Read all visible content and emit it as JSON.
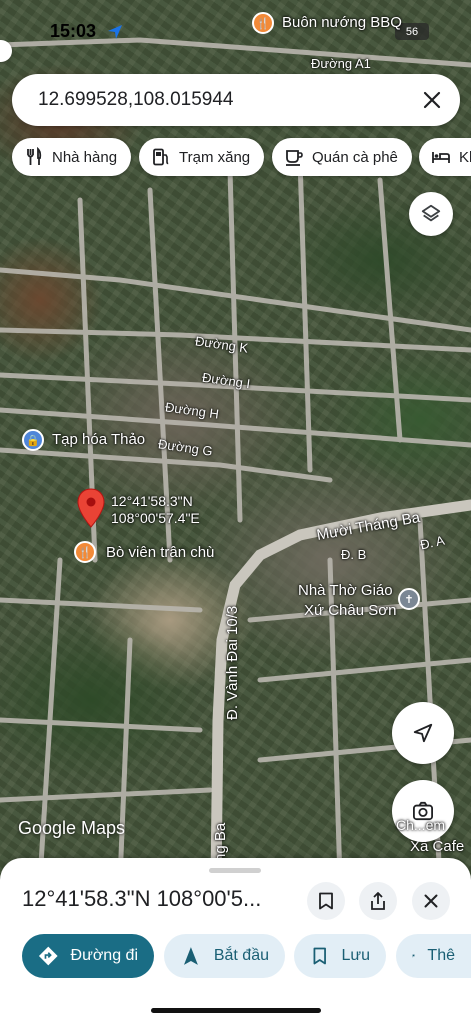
{
  "status_bar": {
    "time": "15:03",
    "battery": "56"
  },
  "search": {
    "query": "12.699528,108.015944"
  },
  "chips": [
    {
      "label": "Nhà hàng",
      "icon": "fork-knife-icon"
    },
    {
      "label": "Trạm xăng",
      "icon": "gas-station-icon"
    },
    {
      "label": "Quán cà phê",
      "icon": "coffee-icon"
    },
    {
      "label": "Kh",
      "icon": "bed-icon"
    }
  ],
  "map": {
    "roads": {
      "a1": "Đường A1",
      "k": "Đường K",
      "i": "Đường I",
      "h": "Đường H",
      "g": "Đường G",
      "muoi_thang_ba": "Mười Tháng Ba",
      "d_b": "Đ. B",
      "d_a": "Đ. A",
      "vanh_dai": "Đ. Vành Đai 10/3",
      "ang_ba": "ng Ba"
    },
    "pois": {
      "buon_nuong": "Buôn nướng BBQ",
      "tap_hoa": "Tạp hóa Thảo",
      "bo_vien": "Bò viên trân chù",
      "nha_tho_line1": "Nhà Thờ Giáo",
      "nha_tho_line2": "Xứ Châu Sơn",
      "xa_cafe": "Xã Cafe"
    },
    "pin_label_line1": "12°41'58.3\"N",
    "pin_label_line2": "108°00'57.4\"E",
    "google_logo": "Google Maps",
    "street_view_label": "Ch...em"
  },
  "sheet": {
    "title": "12°41'58.3\"N 108°00'5...",
    "actions": [
      {
        "label": "Đường đi",
        "icon": "directions-icon"
      },
      {
        "label": "Bắt đầu",
        "icon": "navigation-arrow-icon"
      },
      {
        "label": "Lưu",
        "icon": "bookmark-icon"
      },
      {
        "label": "Thê",
        "icon": "flag-icon"
      }
    ]
  },
  "colors": {
    "primary": "#1a6d85",
    "secondary_bg": "#e2eef6",
    "pin": "#ea4335"
  }
}
